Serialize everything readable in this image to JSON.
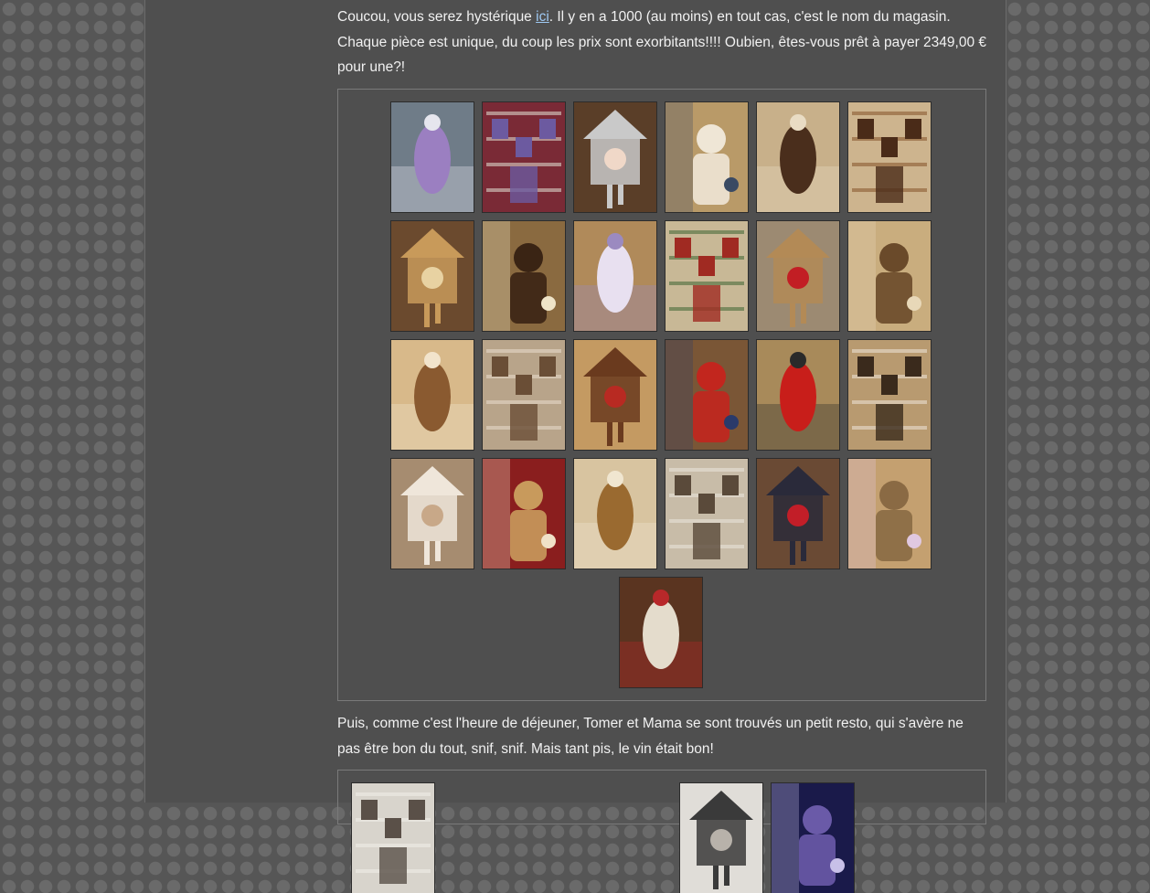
{
  "paragraph1": {
    "before_link": "Coucou, vous serez hystérique ",
    "link": "ici",
    "after_link": ". Il y en a 1000 (au moins) en tout cas, c'est le nom du magasin. Chaque pièce est unique, du coup les prix sont exorbitants!!!! Oubien, êtes-vous prêt à payer 2349,00 € pour une?!"
  },
  "gallery1": {
    "photos": [
      {
        "name": "dirndl-purple",
        "bg": "#6f7c88",
        "fg": "#9b7fc1",
        "accent": "#e6e6ee"
      },
      {
        "name": "dirndl-window",
        "bg": "#7a2a36",
        "fg": "#6c5aa0",
        "accent": "#d9d3c8"
      },
      {
        "name": "couple-cuckoo-clock",
        "bg": "#5a3e28",
        "fg": "#c9c9c9",
        "accent": "#f0d8c8"
      },
      {
        "name": "bear-costume",
        "bg": "#b99a68",
        "fg": "#efe6d6",
        "accent": "#3a4a63"
      },
      {
        "name": "cuckoo-clock-wall",
        "bg": "#c8b08a",
        "fg": "#4a2e1c",
        "accent": "#e9dcc4"
      },
      {
        "name": "large-cuckoo-clock",
        "bg": "#cdb48e",
        "fg": "#4a2b18",
        "accent": "#8a5a30"
      },
      {
        "name": "carved-clock-birds",
        "bg": "#6b4a2e",
        "fg": "#c89a5a",
        "accent": "#e8d2a2"
      },
      {
        "name": "chalet-cuckoo-clock",
        "bg": "#8a6a40",
        "fg": "#3a2414",
        "accent": "#efe4c8"
      },
      {
        "name": "shop-staircase",
        "bg": "#b08a5a",
        "fg": "#e8e0f0",
        "accent": "#9b8ac0"
      },
      {
        "name": "christmas-decor",
        "bg": "#c8b896",
        "fg": "#a02a22",
        "accent": "#4a6a3a"
      },
      {
        "name": "teddy-bear-vest",
        "bg": "#9c8a72",
        "fg": "#b38a56",
        "accent": "#c21e24"
      },
      {
        "name": "shop-interior-clock",
        "bg": "#c9ad7e",
        "fg": "#6a4a2a",
        "accent": "#e8d8b8"
      },
      {
        "name": "plush-shelves",
        "bg": "#d8b98a",
        "fg": "#8a5a30",
        "accent": "#f2e4cc"
      },
      {
        "name": "bear-display",
        "bg": "#b8a48a",
        "fg": "#6a4e36",
        "accent": "#e4d8c8"
      },
      {
        "name": "toy-shelves",
        "bg": "#c49a62",
        "fg": "#6a3a1e",
        "accent": "#b82a22"
      },
      {
        "name": "nutcracker",
        "bg": "#7a5636",
        "fg": "#c2261e",
        "accent": "#2a3a6a"
      },
      {
        "name": "bollenhut-figure",
        "bg": "#a88a5a",
        "fg": "#c81e1a",
        "accent": "#2a2a2a"
      },
      {
        "name": "christmas-pyramid",
        "bg": "#b89a70",
        "fg": "#3a2a1c",
        "accent": "#eae0d0"
      },
      {
        "name": "white-teddy-bear",
        "bg": "#a68c70",
        "fg": "#efe6da",
        "accent": "#c8a888"
      },
      {
        "name": "carved-chalet-clock",
        "bg": "#8a1e1e",
        "fg": "#c89a5c",
        "accent": "#f0e2c8"
      },
      {
        "name": "grandfather-clock",
        "bg": "#d8c4a0",
        "fg": "#9a6a30",
        "accent": "#f0e6d0"
      },
      {
        "name": "metal-sculpture",
        "bg": "#c8bca8",
        "fg": "#5a4a3a",
        "accent": "#e8e2d8"
      },
      {
        "name": "traditional-dress",
        "bg": "#6a4a34",
        "fg": "#2a2a3a",
        "accent": "#c21e28"
      },
      {
        "name": "craft-display",
        "bg": "#c4a070",
        "fg": "#8a6a44",
        "accent": "#e0c8e0"
      },
      {
        "name": "porcelain-dolls",
        "bg": "#5a3420",
        "fg": "#e4dccc",
        "accent": "#b8282a"
      }
    ]
  },
  "paragraph2": "Puis, comme c'est l'heure de déjeuner, Tomer et Mama se sont trouvés un petit resto, qui s'avère ne pas être bon du tout, snif, snif. Mais tant pis, le vin était bon!",
  "gallery2": {
    "photos": [
      {
        "name": "restaurant-door",
        "bg": "#d8d4cc",
        "fg": "#5a5048",
        "accent": "#f0ece6"
      },
      {
        "name": "table-dish",
        "bg": "#e0ddd8",
        "fg": "#3a3a3a",
        "accent": "#b8b2aa"
      },
      {
        "name": "wine-glass",
        "bg": "#1a1a4a",
        "fg": "#6a5aa8",
        "accent": "#c8c0e8"
      }
    ]
  }
}
